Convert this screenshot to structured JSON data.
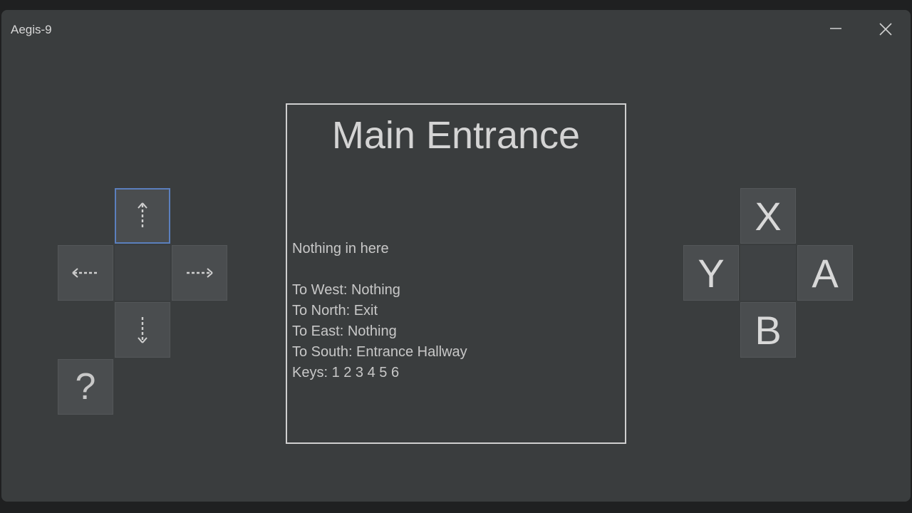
{
  "window": {
    "title": "Aegis-9",
    "minimize_icon": "minimize-icon",
    "close_icon": "close-icon"
  },
  "dpad": {
    "up_icon": "arrow-up-icon",
    "left_icon": "arrow-left-icon",
    "right_icon": "arrow-right-icon",
    "down_icon": "arrow-down-icon",
    "help_label": "?"
  },
  "face_buttons": {
    "x": "X",
    "y": "Y",
    "a": "A",
    "b": "B"
  },
  "room": {
    "title": "Main Entrance",
    "contents": "Nothing in here",
    "exits": {
      "west": "To West: Nothing",
      "north": "To North: Exit",
      "east": "To East: Nothing",
      "south": "To South: Entrance Hallway"
    },
    "keys": "Keys: 1 2 3 4 5 6"
  },
  "colors": {
    "background": "#3a3d3e",
    "button": "#4a4d4f",
    "focus_border": "#5b7fbd",
    "text": "#c8c8c8"
  }
}
